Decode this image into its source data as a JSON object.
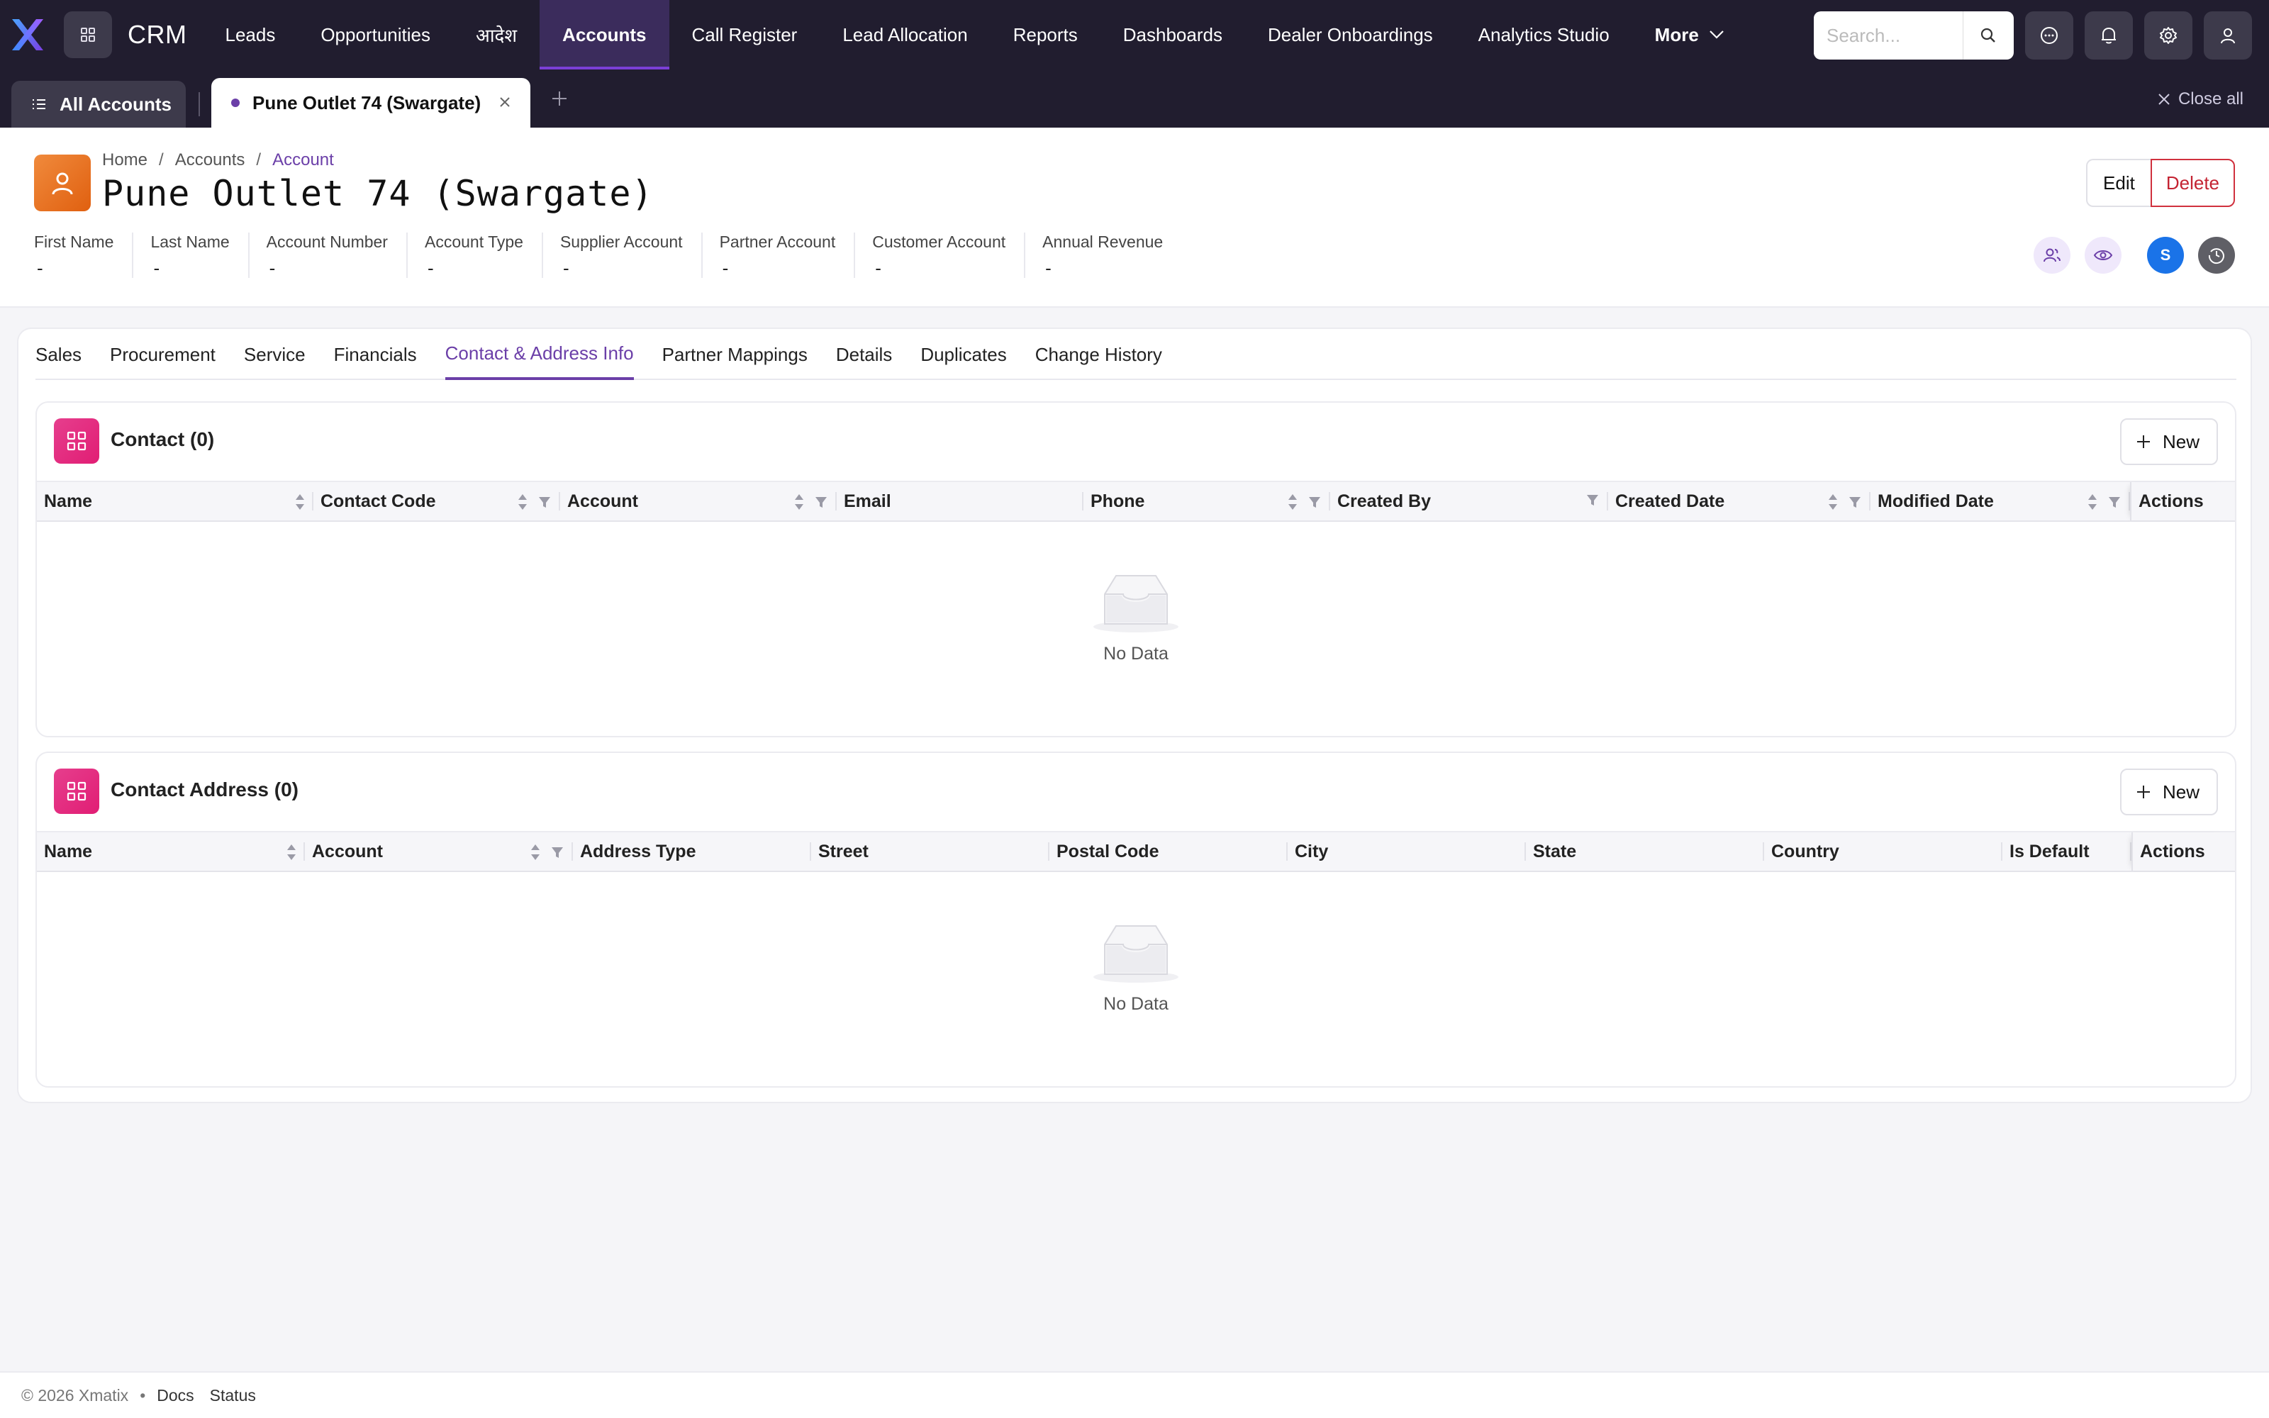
{
  "nav": {
    "brand": "CRM",
    "items": [
      {
        "label": "Leads"
      },
      {
        "label": "Opportunities"
      },
      {
        "label": "आदेश"
      },
      {
        "label": "Accounts",
        "active": true
      },
      {
        "label": "Call Register"
      },
      {
        "label": "Lead Allocation"
      },
      {
        "label": "Reports"
      },
      {
        "label": "Dashboards"
      },
      {
        "label": "Dealer Onboardings"
      },
      {
        "label": "Analytics Studio"
      },
      {
        "label": "More"
      }
    ],
    "search_placeholder": "Search...",
    "icons": [
      "chat-icon",
      "bell-icon",
      "gear-icon",
      "user-icon"
    ]
  },
  "tabstrip": {
    "all_label": "All Accounts",
    "active_tab_label": "Pune Outlet 74 (Swargate)",
    "close_all_label": "Close all"
  },
  "header": {
    "breadcrumb": [
      "Home",
      "Accounts",
      "Account"
    ],
    "title": "Pune Outlet 74 (Swargate)",
    "edit_label": "Edit",
    "delete_label": "Delete",
    "avatar_initial": "S",
    "fields": [
      {
        "label": "First Name",
        "value": "-"
      },
      {
        "label": "Last Name",
        "value": "-"
      },
      {
        "label": "Account Number",
        "value": "-"
      },
      {
        "label": "Account Type",
        "value": "-"
      },
      {
        "label": "Supplier Account",
        "value": "-"
      },
      {
        "label": "Partner Account",
        "value": "-"
      },
      {
        "label": "Customer Account",
        "value": "-"
      },
      {
        "label": "Annual Revenue",
        "value": "-"
      }
    ]
  },
  "tabs": [
    {
      "label": "Sales"
    },
    {
      "label": "Procurement"
    },
    {
      "label": "Service"
    },
    {
      "label": "Financials"
    },
    {
      "label": "Contact & Address Info",
      "active": true
    },
    {
      "label": "Partner Mappings"
    },
    {
      "label": "Details"
    },
    {
      "label": "Duplicates"
    },
    {
      "label": "Change History"
    }
  ],
  "contact": {
    "title": "Contact (0)",
    "new_label": "New",
    "empty_text": "No Data",
    "columns": [
      "Name",
      "Contact Code",
      "Account",
      "Email",
      "Phone",
      "Created By",
      "Created Date",
      "Modified Date",
      "Actions"
    ]
  },
  "address": {
    "title": "Contact Address (0)",
    "new_label": "New",
    "empty_text": "No Data",
    "columns": [
      "Name",
      "Account",
      "Address Type",
      "Street",
      "Postal Code",
      "City",
      "State",
      "Country",
      "Is Default",
      "Actions"
    ]
  },
  "footer": {
    "copyright": "© 2026 Xmatix",
    "links": [
      "Docs",
      "Status"
    ]
  },
  "colors": {
    "nav_bg": "#211d2f",
    "accent": "#6b3fa8",
    "delete": "#c42332",
    "panel_icon": "#e11d74",
    "avatar": "#e8701f"
  }
}
